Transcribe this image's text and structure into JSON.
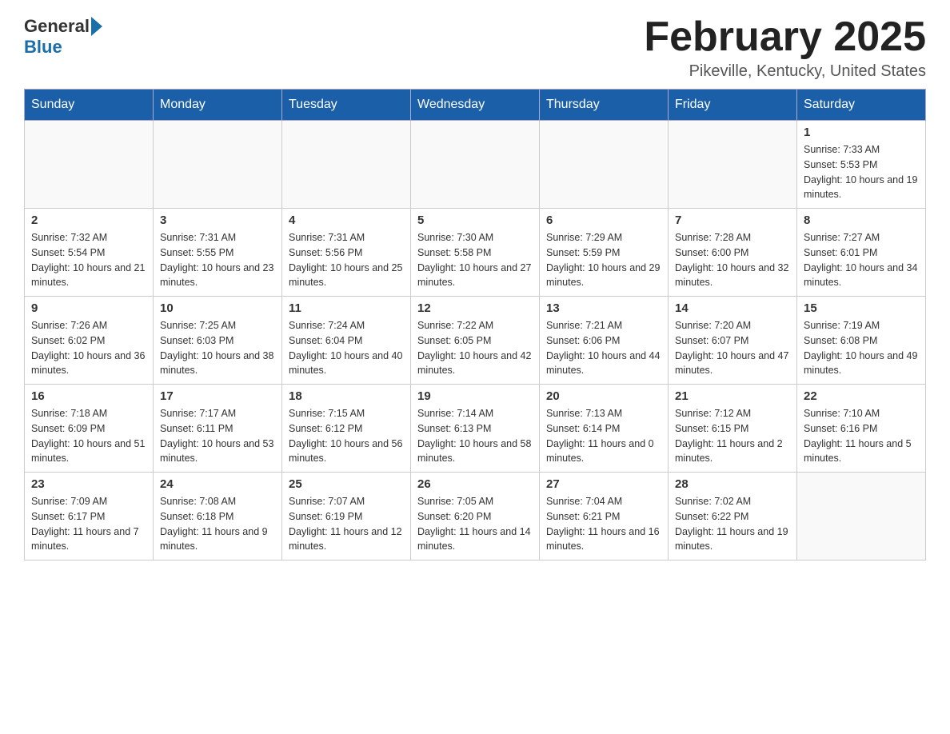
{
  "header": {
    "logo_general": "General",
    "logo_blue": "Blue",
    "month_title": "February 2025",
    "location": "Pikeville, Kentucky, United States"
  },
  "days_of_week": [
    "Sunday",
    "Monday",
    "Tuesday",
    "Wednesday",
    "Thursday",
    "Friday",
    "Saturday"
  ],
  "weeks": [
    [
      {
        "day": "",
        "info": ""
      },
      {
        "day": "",
        "info": ""
      },
      {
        "day": "",
        "info": ""
      },
      {
        "day": "",
        "info": ""
      },
      {
        "day": "",
        "info": ""
      },
      {
        "day": "",
        "info": ""
      },
      {
        "day": "1",
        "info": "Sunrise: 7:33 AM\nSunset: 5:53 PM\nDaylight: 10 hours and 19 minutes."
      }
    ],
    [
      {
        "day": "2",
        "info": "Sunrise: 7:32 AM\nSunset: 5:54 PM\nDaylight: 10 hours and 21 minutes."
      },
      {
        "day": "3",
        "info": "Sunrise: 7:31 AM\nSunset: 5:55 PM\nDaylight: 10 hours and 23 minutes."
      },
      {
        "day": "4",
        "info": "Sunrise: 7:31 AM\nSunset: 5:56 PM\nDaylight: 10 hours and 25 minutes."
      },
      {
        "day": "5",
        "info": "Sunrise: 7:30 AM\nSunset: 5:58 PM\nDaylight: 10 hours and 27 minutes."
      },
      {
        "day": "6",
        "info": "Sunrise: 7:29 AM\nSunset: 5:59 PM\nDaylight: 10 hours and 29 minutes."
      },
      {
        "day": "7",
        "info": "Sunrise: 7:28 AM\nSunset: 6:00 PM\nDaylight: 10 hours and 32 minutes."
      },
      {
        "day": "8",
        "info": "Sunrise: 7:27 AM\nSunset: 6:01 PM\nDaylight: 10 hours and 34 minutes."
      }
    ],
    [
      {
        "day": "9",
        "info": "Sunrise: 7:26 AM\nSunset: 6:02 PM\nDaylight: 10 hours and 36 minutes."
      },
      {
        "day": "10",
        "info": "Sunrise: 7:25 AM\nSunset: 6:03 PM\nDaylight: 10 hours and 38 minutes."
      },
      {
        "day": "11",
        "info": "Sunrise: 7:24 AM\nSunset: 6:04 PM\nDaylight: 10 hours and 40 minutes."
      },
      {
        "day": "12",
        "info": "Sunrise: 7:22 AM\nSunset: 6:05 PM\nDaylight: 10 hours and 42 minutes."
      },
      {
        "day": "13",
        "info": "Sunrise: 7:21 AM\nSunset: 6:06 PM\nDaylight: 10 hours and 44 minutes."
      },
      {
        "day": "14",
        "info": "Sunrise: 7:20 AM\nSunset: 6:07 PM\nDaylight: 10 hours and 47 minutes."
      },
      {
        "day": "15",
        "info": "Sunrise: 7:19 AM\nSunset: 6:08 PM\nDaylight: 10 hours and 49 minutes."
      }
    ],
    [
      {
        "day": "16",
        "info": "Sunrise: 7:18 AM\nSunset: 6:09 PM\nDaylight: 10 hours and 51 minutes."
      },
      {
        "day": "17",
        "info": "Sunrise: 7:17 AM\nSunset: 6:11 PM\nDaylight: 10 hours and 53 minutes."
      },
      {
        "day": "18",
        "info": "Sunrise: 7:15 AM\nSunset: 6:12 PM\nDaylight: 10 hours and 56 minutes."
      },
      {
        "day": "19",
        "info": "Sunrise: 7:14 AM\nSunset: 6:13 PM\nDaylight: 10 hours and 58 minutes."
      },
      {
        "day": "20",
        "info": "Sunrise: 7:13 AM\nSunset: 6:14 PM\nDaylight: 11 hours and 0 minutes."
      },
      {
        "day": "21",
        "info": "Sunrise: 7:12 AM\nSunset: 6:15 PM\nDaylight: 11 hours and 2 minutes."
      },
      {
        "day": "22",
        "info": "Sunrise: 7:10 AM\nSunset: 6:16 PM\nDaylight: 11 hours and 5 minutes."
      }
    ],
    [
      {
        "day": "23",
        "info": "Sunrise: 7:09 AM\nSunset: 6:17 PM\nDaylight: 11 hours and 7 minutes."
      },
      {
        "day": "24",
        "info": "Sunrise: 7:08 AM\nSunset: 6:18 PM\nDaylight: 11 hours and 9 minutes."
      },
      {
        "day": "25",
        "info": "Sunrise: 7:07 AM\nSunset: 6:19 PM\nDaylight: 11 hours and 12 minutes."
      },
      {
        "day": "26",
        "info": "Sunrise: 7:05 AM\nSunset: 6:20 PM\nDaylight: 11 hours and 14 minutes."
      },
      {
        "day": "27",
        "info": "Sunrise: 7:04 AM\nSunset: 6:21 PM\nDaylight: 11 hours and 16 minutes."
      },
      {
        "day": "28",
        "info": "Sunrise: 7:02 AM\nSunset: 6:22 PM\nDaylight: 11 hours and 19 minutes."
      },
      {
        "day": "",
        "info": ""
      }
    ]
  ]
}
